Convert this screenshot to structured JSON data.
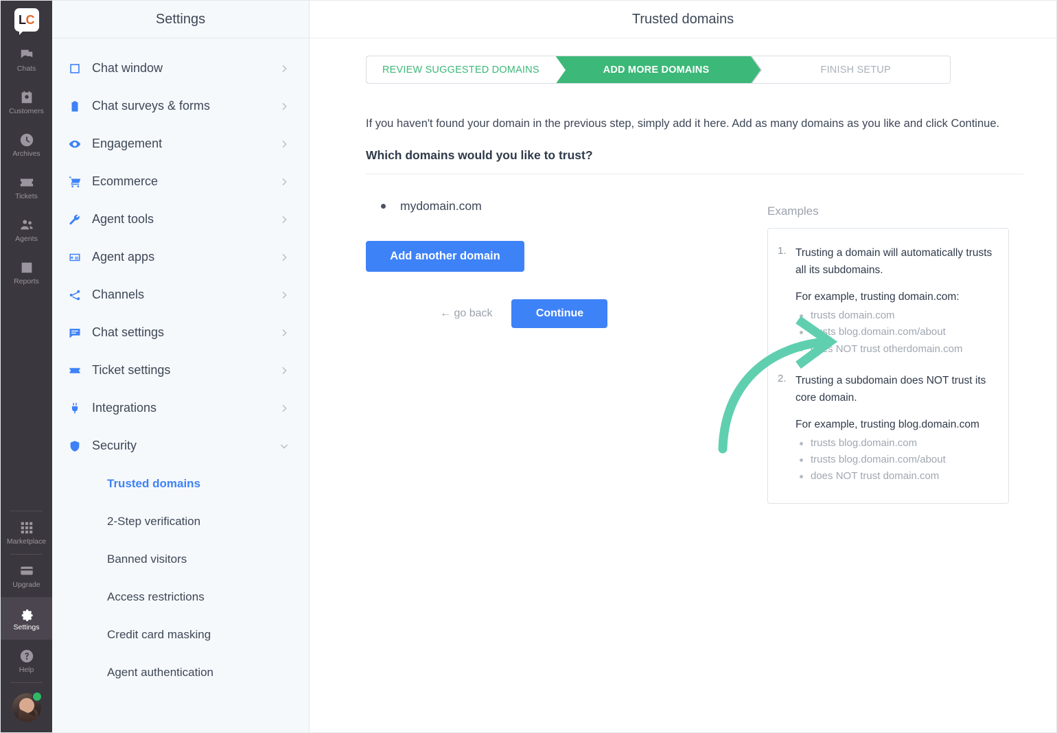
{
  "rail": {
    "logo": {
      "text_left": "L",
      "text_right": "C",
      "name": "livechat-logo"
    },
    "items": [
      {
        "label": "Chats",
        "icon": "chats-icon",
        "active": false
      },
      {
        "label": "Customers",
        "icon": "customers-icon",
        "active": false
      },
      {
        "label": "Archives",
        "icon": "archives-icon",
        "active": false
      },
      {
        "label": "Tickets",
        "icon": "tickets-icon",
        "active": false
      },
      {
        "label": "Agents",
        "icon": "agents-icon",
        "active": false
      },
      {
        "label": "Reports",
        "icon": "reports-icon",
        "active": false
      }
    ],
    "bottom_items": [
      {
        "label": "Marketplace",
        "icon": "marketplace-icon",
        "active": false
      },
      {
        "label": "Upgrade",
        "icon": "upgrade-icon",
        "active": false
      },
      {
        "label": "Settings",
        "icon": "gear-icon",
        "active": true
      },
      {
        "label": "Help",
        "icon": "help-icon",
        "active": false
      }
    ],
    "avatar": {
      "name": "user-avatar",
      "status": "online",
      "status_color": "#2fb965"
    }
  },
  "sidebar": {
    "title": "Settings",
    "items": [
      {
        "label": "Chat window",
        "icon": "window-icon"
      },
      {
        "label": "Chat surveys & forms",
        "icon": "clipboard-icon"
      },
      {
        "label": "Engagement",
        "icon": "eye-icon"
      },
      {
        "label": "Ecommerce",
        "icon": "cart-icon"
      },
      {
        "label": "Agent tools",
        "icon": "wrench-icon"
      },
      {
        "label": "Agent apps",
        "icon": "apps-icon"
      },
      {
        "label": "Channels",
        "icon": "channels-icon"
      },
      {
        "label": "Chat settings",
        "icon": "chat-bubble-icon"
      },
      {
        "label": "Ticket settings",
        "icon": "ticket-icon"
      },
      {
        "label": "Integrations",
        "icon": "plug-icon"
      },
      {
        "label": "Security",
        "icon": "shield-icon",
        "expanded": true
      }
    ],
    "security_subitems": [
      {
        "label": "Trusted domains",
        "active": true
      },
      {
        "label": "2-Step verification",
        "active": false
      },
      {
        "label": "Banned visitors",
        "active": false
      },
      {
        "label": "Access restrictions",
        "active": false
      },
      {
        "label": "Credit card masking",
        "active": false
      },
      {
        "label": "Agent authentication",
        "active": false
      }
    ]
  },
  "main": {
    "title": "Trusted domains",
    "stepper": {
      "steps": [
        {
          "label": "REVIEW SUGGESTED DOMAINS",
          "state": "completed"
        },
        {
          "label": "ADD MORE DOMAINS",
          "state": "active"
        },
        {
          "label": "FINISH SETUP",
          "state": "upcoming"
        }
      ],
      "active_color": "#3cb878"
    },
    "intro": "If you haven't found your domain in the previous step, simply add it here. Add as many domains as you like and click Continue.",
    "question": "Which domains would you like to trust?",
    "domains": [
      "mydomain.com"
    ],
    "add_domain_label": "Add another domain",
    "go_back_label": "← go back",
    "continue_label": "Continue",
    "primary_color": "#3e82f7",
    "examples": {
      "title": "Examples",
      "items": [
        {
          "head": "Trusting a domain will automatically trusts all its subdomains.",
          "sub": "For example, trusting domain.com:",
          "bullets": [
            "trusts domain.com",
            "trusts blog.domain.com/about",
            "does NOT trust otherdomain.com"
          ]
        },
        {
          "head": "Trusting a subdomain does NOT trust its core domain.",
          "sub": "For example, trusting blog.domain.com",
          "bullets": [
            "trusts blog.domain.com",
            "trusts blog.domain.com/about",
            "does NOT trust domain.com"
          ]
        }
      ]
    },
    "annotation": {
      "name": "highlight-arrow",
      "color": "#5fcfb0",
      "points_to": "Continue"
    }
  }
}
